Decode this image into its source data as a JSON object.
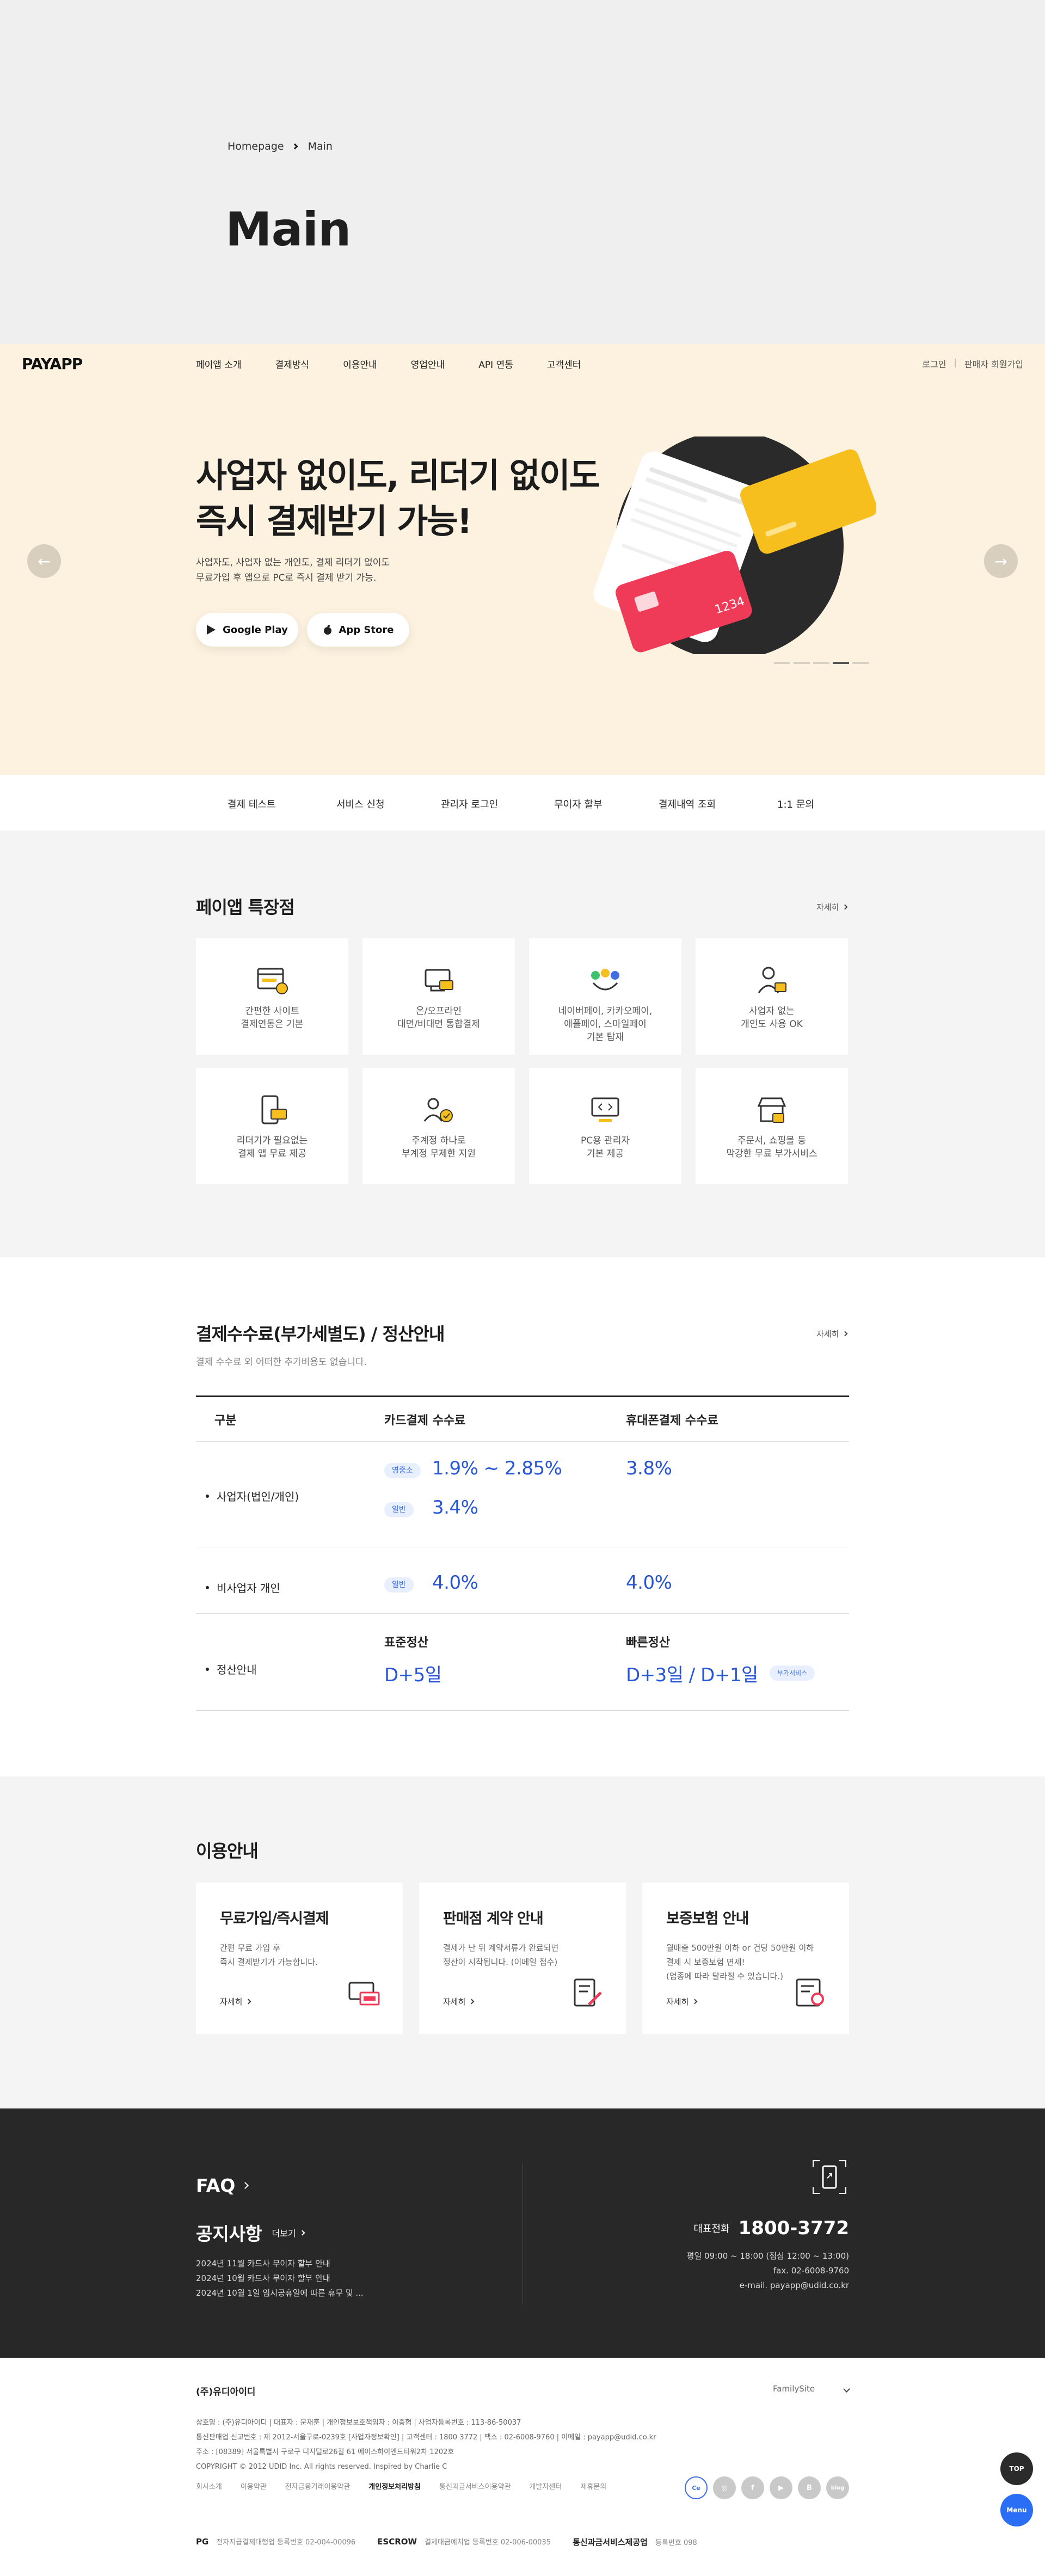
{
  "breadcrumb": {
    "home": "Homepage",
    "current": "Main"
  },
  "page_title": "Main",
  "logo": "PAYAPP",
  "nav": {
    "items": [
      "페이앱 소개",
      "결제방식",
      "이용안내",
      "영업안내",
      "API 연동",
      "고객센터"
    ],
    "login": "로그인",
    "signup": "판매자 회원가입"
  },
  "hero": {
    "line1": "사업자 없이도, 리더기 없이도",
    "line2": "즉시 결제받기 가능!",
    "desc1": "사업자도, 사업자 없는 개인도, 결제 리더기 없이도",
    "desc2": "무료가입 후 앱으로 PC로 즉시 결제 받기 가능.",
    "google": "Google Play",
    "apple": "App Store",
    "card_number": "1234",
    "slides": 5,
    "active_slide": 4
  },
  "quick": [
    "결제 테스트",
    "서비스 신청",
    "관리자 로그인",
    "무이자 할부",
    "결제내역 조회",
    "1:1 문의"
  ],
  "features": {
    "title": "페이앱 특장점",
    "more": "자세히",
    "cards": [
      {
        "icon": "web-payment-icon",
        "label": "간편한 사이트\n결제연동은 기본"
      },
      {
        "icon": "pos-terminal-icon",
        "label": "온/오프라인\n대면/비대면 통합결제"
      },
      {
        "icon": "easy-pay-icon",
        "label": "네이버페이, 카카오페이,\n애플페이, 스마일페이\n기본 탑재"
      },
      {
        "icon": "person-id-icon",
        "label": "사업자 없는\n개인도 사용 OK"
      },
      {
        "icon": "mobile-card-icon",
        "label": "리더기가 필요없는\n결제 앱 무료 제공"
      },
      {
        "icon": "multi-account-icon",
        "label": "주계정 하나로\n부계정 무제한 지원"
      },
      {
        "icon": "pc-admin-icon",
        "label": "PC용 관리자\n기본 제공"
      },
      {
        "icon": "shop-addon-icon",
        "label": "주문서, 쇼핑몰 등\n막강한 무료 부가서비스"
      }
    ]
  },
  "fee": {
    "title": "결제수수료(부가세별도) / 정산안내",
    "subtitle": "결제 수수료 외 어떠한 추가비용도 없습니다.",
    "more": "자세히",
    "headers": [
      "구분",
      "카드결제 수수료",
      "휴대폰결제 수수료"
    ],
    "rows": [
      {
        "label": "사업자(법인/개인)",
        "card": [
          {
            "tag": "영중소",
            "rate": "1.9% ~ 2.85%"
          },
          {
            "tag": "일반",
            "rate": "3.4%"
          }
        ],
        "phone": "3.8%"
      },
      {
        "label": "비사업자 개인",
        "card": [
          {
            "tag": "일반",
            "rate": "4.0%"
          }
        ],
        "phone": "4.0%"
      }
    ],
    "settle": {
      "label": "정산안내",
      "standard_title": "표준정산",
      "standard": "D+5일",
      "fast_title": "빠른정산",
      "fast": "D+3일 / D+1일",
      "fast_tag": "부가서비스"
    }
  },
  "usage": {
    "title": "이용안내",
    "cards": [
      {
        "title": "무료가입/즉시결제",
        "desc": "간편 무료 가입 후\n즉시 결제받기가 가능합니다.",
        "link": "자세히"
      },
      {
        "title": "판매점 계약 안내",
        "desc": "결제가 난 뒤 계약서류가 완료되면\n정산이 시작됩니다. (이메일 접수)",
        "link": "자세히"
      },
      {
        "title": "보증보험 안내",
        "desc": "월매출 500만원 이하 or 건당 50만원 이하\n결제 시 보증보험 면제!\n(업종에 따라 달라질 수 있습니다.)",
        "link": "자세히"
      }
    ]
  },
  "support": {
    "faq": "FAQ",
    "notice": "공지사항",
    "notice_more": "더보기",
    "notices": [
      "2024년 11월 카드사 무이자 할부 안내",
      "2024년 10월 카드사 무이자 할부 안내",
      "2024년 10월 1일 임시공휴일에 따른 휴무 및 ..."
    ],
    "call_label": "대표전화",
    "call_number": "1800-3772",
    "hours": "평일 09:00 ~ 18:00 (점심 12:00 ~ 13:00)",
    "fax": "fax. 02-6008-9760",
    "email": "e-mail. payapp@udid.co.kr"
  },
  "footer": {
    "company": "(주)유디아이디",
    "family": "FamilySite",
    "info1": "상호명 : (주)유디아이디   |   대표자 : 문재훈   |   개인정보보호책임자 : 이종협   |   사업자등록번호 : 113-86-50037",
    "info2": "통신판매업 신고번호 : 제 2012-서울구로-0239호 [사업자정보확인]   |   고객센터 : 1800 3772   |   팩스 : 02-6008-9760   |   이메일 : payapp@udid.co.kr",
    "info3": "주소 : [08389] 서울특별시 구로구 디지털로26길 61 에이스하이엔드타워2차 1202호",
    "copyright": "COPYRIGHT © 2012 UDID Inc. All rights reserved. Inspired by Charlie C",
    "links": [
      "회사소개",
      "이용약관",
      "전자금융거래이용약관",
      "개인정보처리방침",
      "통신과금서비스이용약관",
      "개발자센터",
      "제휴문의"
    ],
    "bold_link": "개인정보처리방침",
    "sns": [
      "Ce",
      "◎",
      "f",
      "▶",
      "B",
      "blog"
    ],
    "certs": [
      {
        "name": "PG",
        "text": "전자지급결제대행업 등록번호 02-004-00096"
      },
      {
        "name": "ESCROW",
        "text": "결제대금예치업 등록번호 02-006-00035"
      },
      {
        "name": "통신과금서비스제공업",
        "text": "등록번호 098"
      }
    ],
    "top": "TOP",
    "menu": "Menu"
  },
  "colors": {
    "cream": "#fcf2df",
    "accent_blue": "#2755d6",
    "yellow": "#f7bf1e",
    "red": "#ef3b58",
    "dark": "#282828"
  }
}
